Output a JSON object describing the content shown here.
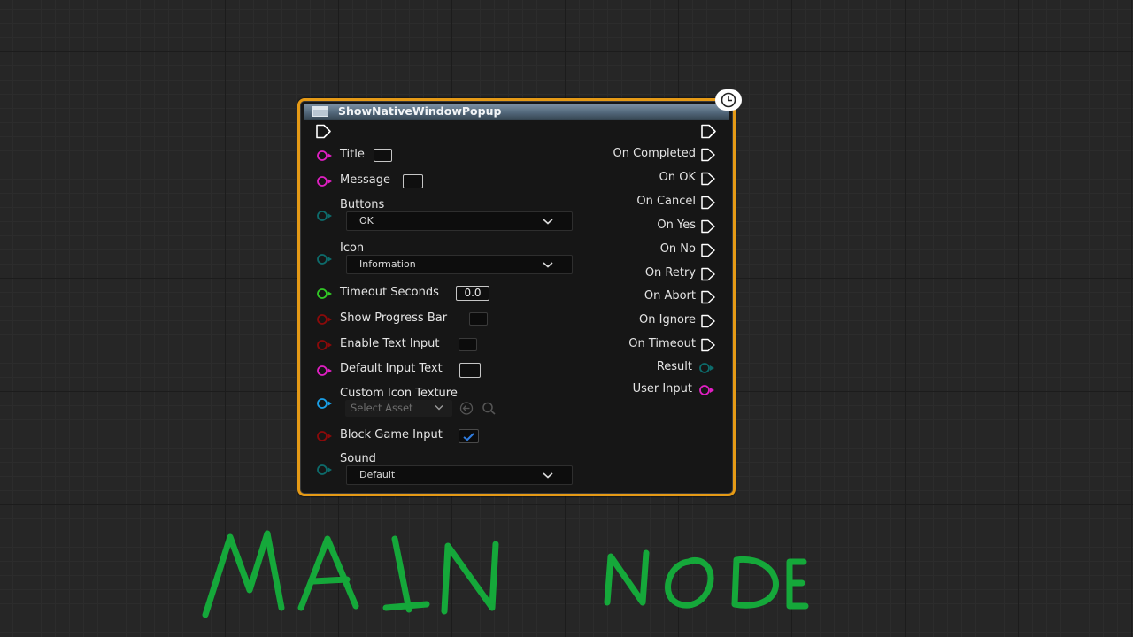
{
  "node": {
    "title": "ShowNativeWindowPopup",
    "inputs": {
      "title": "Title",
      "message": "Message",
      "buttons": "Buttons",
      "buttons_value": "OK",
      "icon": "Icon",
      "icon_value": "Information",
      "timeout_seconds": "Timeout Seconds",
      "timeout_value": "0.0",
      "show_progress_bar": "Show Progress Bar",
      "show_progress_bar_checked": false,
      "enable_text_input": "Enable Text Input",
      "enable_text_input_checked": false,
      "default_input_text": "Default Input Text",
      "custom_icon_texture": "Custom Icon Texture",
      "custom_icon_texture_placeholder": "Select Asset",
      "block_game_input": "Block Game Input",
      "block_game_input_checked": true,
      "sound": "Sound",
      "sound_value": "Default"
    },
    "outputs": {
      "on_completed": "On Completed",
      "on_ok": "On OK",
      "on_cancel": "On Cancel",
      "on_yes": "On Yes",
      "on_no": "On No",
      "on_retry": "On Retry",
      "on_abort": "On Abort",
      "on_ignore": "On Ignore",
      "on_timeout": "On Timeout",
      "result": "Result",
      "user_input": "User Input"
    }
  },
  "annotation": {
    "text": "MAIN NODE",
    "color": "#15a83a"
  },
  "colors": {
    "node_border": "#e59a16",
    "pin_string": "#e01fc3",
    "pin_byte": "#0d6b6b",
    "pin_float": "#32c826",
    "pin_bool": "#8b0a0a",
    "pin_object": "#1aa0e8",
    "exec": "#ffffff"
  },
  "icons": {
    "header": "function-icon",
    "latent": "clock-icon",
    "exec": "exec-arrow-icon",
    "dropdown": "chevron-down-icon",
    "browse": "arrow-left-icon",
    "search": "search-icon"
  }
}
